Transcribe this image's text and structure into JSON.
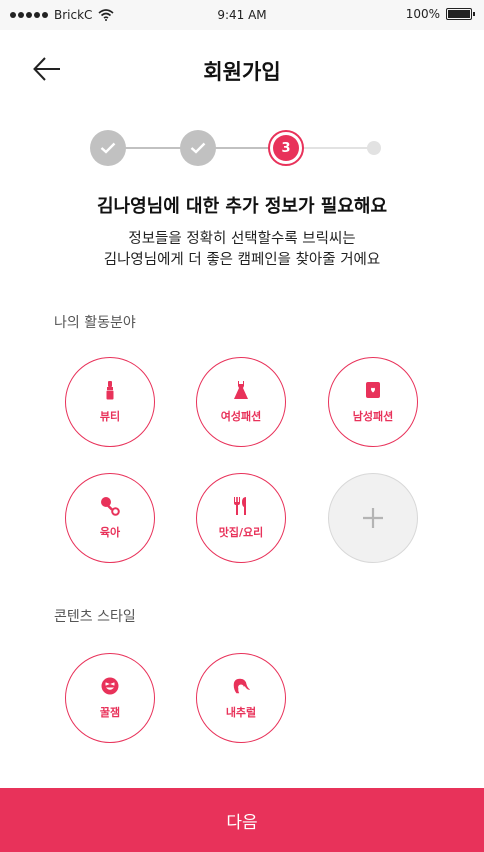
{
  "status_bar": {
    "carrier": "BrickC",
    "time": "9:41 AM",
    "battery": "100%",
    "battery_level": 1.0
  },
  "header": {
    "title": "회원가입",
    "back_icon": "arrow-left-icon"
  },
  "stepper": {
    "current_step": "3",
    "total_steps": 4,
    "completed_steps": 2
  },
  "intro": {
    "headline": "김나영님에 대한 추가 정보가 필요해요",
    "description_line1": "정보들을 정확히 선택할수록 브릭씨는",
    "description_line2": "김나영님에게 더 좋은 캠페인을 찾아줄 거에요"
  },
  "activity": {
    "label": "나의 활동분야",
    "items": [
      {
        "label": "뷰티",
        "icon": "lipstick-icon"
      },
      {
        "label": "여성패션",
        "icon": "dress-icon"
      },
      {
        "label": "남성패션",
        "icon": "wallet-icon"
      },
      {
        "label": "육아",
        "icon": "baby-rattle-icon"
      },
      {
        "label": "맛집/요리",
        "icon": "fork-knife-icon"
      }
    ],
    "add_icon": "plus-icon"
  },
  "content_style": {
    "label": "콘텐츠 스타일",
    "items": [
      {
        "label": "꿀잼",
        "icon": "laughing-face-icon"
      },
      {
        "label": "내추럴",
        "icon": "woman-hair-icon"
      }
    ]
  },
  "footer": {
    "next_label": "다음"
  },
  "colors": {
    "accent": "#e8325a",
    "step_done": "#c1c1c1",
    "step_todo": "#e2e2e2"
  }
}
